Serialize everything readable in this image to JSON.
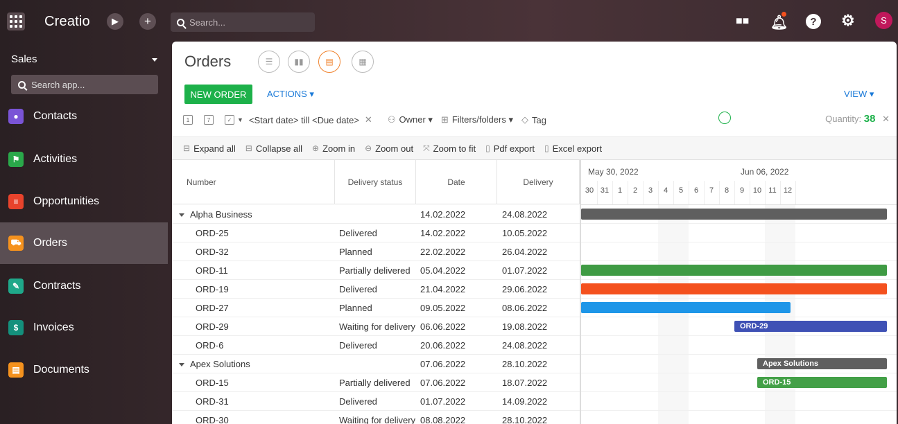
{
  "app": {
    "logo": "Creatio",
    "search_placeholder": "Search...",
    "avatar_initial": "S"
  },
  "sidebar": {
    "workspace": "Sales",
    "search_placeholder": "Search app...",
    "items": [
      {
        "label": "Contacts",
        "color": "#7a54d6",
        "icon": "contact-icon"
      },
      {
        "label": "Activities",
        "color": "#2aa84a",
        "icon": "flag-icon"
      },
      {
        "label": "Opportunities",
        "color": "#e8432c",
        "icon": "funnel-icon"
      },
      {
        "label": "Orders",
        "color": "#f5921e",
        "icon": "cart-icon",
        "active": true
      },
      {
        "label": "Contracts",
        "color": "#1fa88a",
        "icon": "contract-icon"
      },
      {
        "label": "Invoices",
        "color": "#14907c",
        "icon": "invoice-icon"
      },
      {
        "label": "Documents",
        "color": "#f5921e",
        "icon": "document-icon"
      }
    ]
  },
  "page": {
    "title": "Orders",
    "new_order": "NEW ORDER",
    "actions": "ACTIONS ▾",
    "view": "VIEW ▾",
    "filters": {
      "date_range": "<Start date> till <Due date>",
      "owner": "Owner ▾",
      "folders": "Filters/folders ▾",
      "tag": "Tag"
    },
    "quantity_label": "Quantity:",
    "quantity_value": "38"
  },
  "toolbar": {
    "expand_all": "Expand all",
    "collapse_all": "Collapse all",
    "zoom_in": "Zoom in",
    "zoom_out": "Zoom out",
    "zoom_fit": "Zoom to fit",
    "pdf": "Pdf export",
    "excel": "Excel export"
  },
  "grid": {
    "headers": {
      "number": "Number",
      "status": "Delivery status",
      "date": "Date",
      "delivery": "Delivery"
    },
    "rows": [
      {
        "number": "Alpha Business",
        "status": "",
        "date": "14.02.2022",
        "delivery": "24.08.2022",
        "group": true
      },
      {
        "number": "ORD-25",
        "status": "Delivered",
        "date": "14.02.2022",
        "delivery": "10.05.2022"
      },
      {
        "number": "ORD-32",
        "status": "Planned",
        "date": "22.02.2022",
        "delivery": "26.04.2022"
      },
      {
        "number": "ORD-11",
        "status": "Partially delivered",
        "date": "05.04.2022",
        "delivery": "01.07.2022"
      },
      {
        "number": "ORD-19",
        "status": "Delivered",
        "date": "21.04.2022",
        "delivery": "29.06.2022"
      },
      {
        "number": "ORD-27",
        "status": "Planned",
        "date": "09.05.2022",
        "delivery": "08.06.2022"
      },
      {
        "number": "ORD-29",
        "status": "Waiting for delivery",
        "date": "06.06.2022",
        "delivery": "19.08.2022"
      },
      {
        "number": "ORD-6",
        "status": "Delivered",
        "date": "20.06.2022",
        "delivery": "24.08.2022"
      },
      {
        "number": "Apex Solutions",
        "status": "",
        "date": "07.06.2022",
        "delivery": "28.10.2022",
        "group": true
      },
      {
        "number": "ORD-15",
        "status": "Partially delivered",
        "date": "07.06.2022",
        "delivery": "18.07.2022"
      },
      {
        "number": "ORD-31",
        "status": "Delivered",
        "date": "01.07.2022",
        "delivery": "14.09.2022"
      },
      {
        "number": "ORD-30",
        "status": "Waiting for delivery",
        "date": "08.08.2022",
        "delivery": "28.10.2022"
      }
    ]
  },
  "gantt": {
    "weeks": [
      "May 30, 2022",
      "Jun 06, 2022"
    ],
    "days": [
      "30",
      "31",
      "1",
      "2",
      "3",
      "4",
      "5",
      "6",
      "7",
      "8",
      "9",
      "10",
      "11",
      "12"
    ],
    "bar_labels": {
      "ord29": "ORD-29",
      "apex": "Apex Solutions",
      "ord15": "ORD-15"
    },
    "colors": {
      "group": "#5f5f5f",
      "green": "#3f9b44",
      "orange": "#f4511e",
      "blue": "#1e96e8",
      "indigo": "#3f51b5",
      "green_light": "#43a047"
    }
  }
}
